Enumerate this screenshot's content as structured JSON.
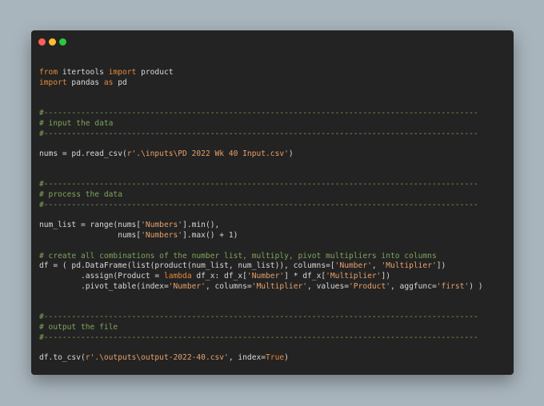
{
  "window": {
    "controls": [
      {
        "name": "close",
        "color": "#ff5f56"
      },
      {
        "name": "minimize",
        "color": "#ffbd2e"
      },
      {
        "name": "maximize",
        "color": "#27c93f"
      }
    ]
  },
  "colors": {
    "background": "#a9b5bd",
    "editor": "#232323",
    "keyword": "#e48a3c",
    "string": "#e6a06a",
    "comment": "#7fa55a",
    "text": "#d8d8d8"
  },
  "code": {
    "lines": [
      [
        {
          "t": "kw",
          "v": "from"
        },
        {
          "t": "def",
          "v": " itertools "
        },
        {
          "t": "kw",
          "v": "import"
        },
        {
          "t": "def",
          "v": " product"
        }
      ],
      [
        {
          "t": "kw",
          "v": "import"
        },
        {
          "t": "def",
          "v": " pandas "
        },
        {
          "t": "kw",
          "v": "as"
        },
        {
          "t": "def",
          "v": " pd"
        }
      ],
      [],
      [],
      [
        {
          "t": "com",
          "v": "#----------------------------------------------------------------------------------------------"
        }
      ],
      [
        {
          "t": "com",
          "v": "# input the data"
        }
      ],
      [
        {
          "t": "com",
          "v": "#----------------------------------------------------------------------------------------------"
        }
      ],
      [],
      [
        {
          "t": "def",
          "v": "nums = pd.read_csv("
        },
        {
          "t": "str",
          "v": "r'.\\inputs\\PD 2022 Wk 40 Input.csv'"
        },
        {
          "t": "def",
          "v": ")"
        }
      ],
      [],
      [],
      [
        {
          "t": "com",
          "v": "#----------------------------------------------------------------------------------------------"
        }
      ],
      [
        {
          "t": "com",
          "v": "# process the data"
        }
      ],
      [
        {
          "t": "com",
          "v": "#----------------------------------------------------------------------------------------------"
        }
      ],
      [],
      [
        {
          "t": "def",
          "v": "num_list = range(nums["
        },
        {
          "t": "str",
          "v": "'Numbers'"
        },
        {
          "t": "def",
          "v": "].min(),"
        }
      ],
      [
        {
          "t": "def",
          "v": "                 nums["
        },
        {
          "t": "str",
          "v": "'Numbers'"
        },
        {
          "t": "def",
          "v": "].max() + 1)"
        }
      ],
      [],
      [
        {
          "t": "com",
          "v": "# create all combinations of the number list, multiply, pivot multipliers into columns"
        }
      ],
      [
        {
          "t": "def",
          "v": "df = ( pd.DataFrame(list(product(num_list, num_list)), columns=["
        },
        {
          "t": "str",
          "v": "'Number'"
        },
        {
          "t": "def",
          "v": ", "
        },
        {
          "t": "str",
          "v": "'Multiplier'"
        },
        {
          "t": "def",
          "v": "])"
        }
      ],
      [
        {
          "t": "def",
          "v": "         .assign(Product = "
        },
        {
          "t": "kw",
          "v": "lambda"
        },
        {
          "t": "def",
          "v": " df_x: df_x["
        },
        {
          "t": "str",
          "v": "'Number'"
        },
        {
          "t": "def",
          "v": "] * df_x["
        },
        {
          "t": "str",
          "v": "'Multiplier'"
        },
        {
          "t": "def",
          "v": "])"
        }
      ],
      [
        {
          "t": "def",
          "v": "         .pivot_table(index="
        },
        {
          "t": "str",
          "v": "'Number'"
        },
        {
          "t": "def",
          "v": ", columns="
        },
        {
          "t": "str",
          "v": "'Multiplier'"
        },
        {
          "t": "def",
          "v": ", values="
        },
        {
          "t": "str",
          "v": "'Product'"
        },
        {
          "t": "def",
          "v": ", aggfunc="
        },
        {
          "t": "str",
          "v": "'first'"
        },
        {
          "t": "def",
          "v": ") )"
        }
      ],
      [],
      [],
      [
        {
          "t": "com",
          "v": "#----------------------------------------------------------------------------------------------"
        }
      ],
      [
        {
          "t": "com",
          "v": "# output the file"
        }
      ],
      [
        {
          "t": "com",
          "v": "#----------------------------------------------------------------------------------------------"
        }
      ],
      [],
      [
        {
          "t": "def",
          "v": "df.to_csv("
        },
        {
          "t": "str",
          "v": "r'.\\outputs\\output-2022-40.csv'"
        },
        {
          "t": "def",
          "v": ", index="
        },
        {
          "t": "kw",
          "v": "True"
        },
        {
          "t": "def",
          "v": ")"
        }
      ]
    ]
  }
}
